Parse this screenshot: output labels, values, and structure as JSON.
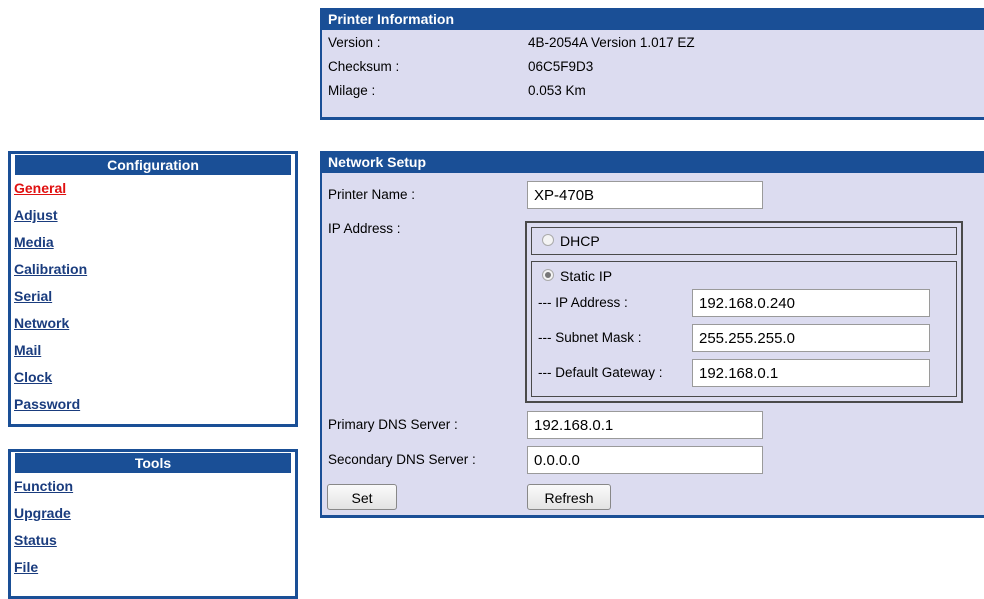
{
  "printer_info": {
    "title": "Printer Information",
    "rows": [
      {
        "label": "Version :",
        "value": "4B-2054A Version 1.017 EZ"
      },
      {
        "label": "Checksum :",
        "value": "06C5F9D3"
      },
      {
        "label": "Milage :",
        "value": "0.053 Km"
      }
    ]
  },
  "configuration": {
    "title": "Configuration",
    "items": [
      "General",
      "Adjust",
      "Media",
      "Calibration",
      "Serial",
      "Network",
      "Mail",
      "Clock",
      "Password"
    ],
    "active": "General"
  },
  "tools": {
    "title": "Tools",
    "items": [
      "Function",
      "Upgrade",
      "Status",
      "File"
    ]
  },
  "network_setup": {
    "title": "Network Setup",
    "printer_name_label": "Printer Name :",
    "printer_name_value": "XP-470B",
    "ip_address_label": "IP Address :",
    "dhcp_label": "DHCP",
    "dhcp_selected": false,
    "static_label": "Static IP",
    "static_selected": true,
    "static_ip_label": "--- IP Address :",
    "static_ip_value": "192.168.0.240",
    "subnet_label": "--- Subnet Mask :",
    "subnet_value": "255.255.255.0",
    "gateway_label": "--- Default Gateway :",
    "gateway_value": "192.168.0.1",
    "primary_dns_label": "Primary DNS Server :",
    "primary_dns_value": "192.168.0.1",
    "secondary_dns_label": "Secondary DNS Server :",
    "secondary_dns_value": "0.0.0.0",
    "set_label": "Set",
    "refresh_label": "Refresh"
  },
  "colors": {
    "header_blue": "#1a4f96",
    "panel_bg": "#dcdcf0",
    "active_link": "#e01010",
    "link": "#1a3c7e"
  }
}
